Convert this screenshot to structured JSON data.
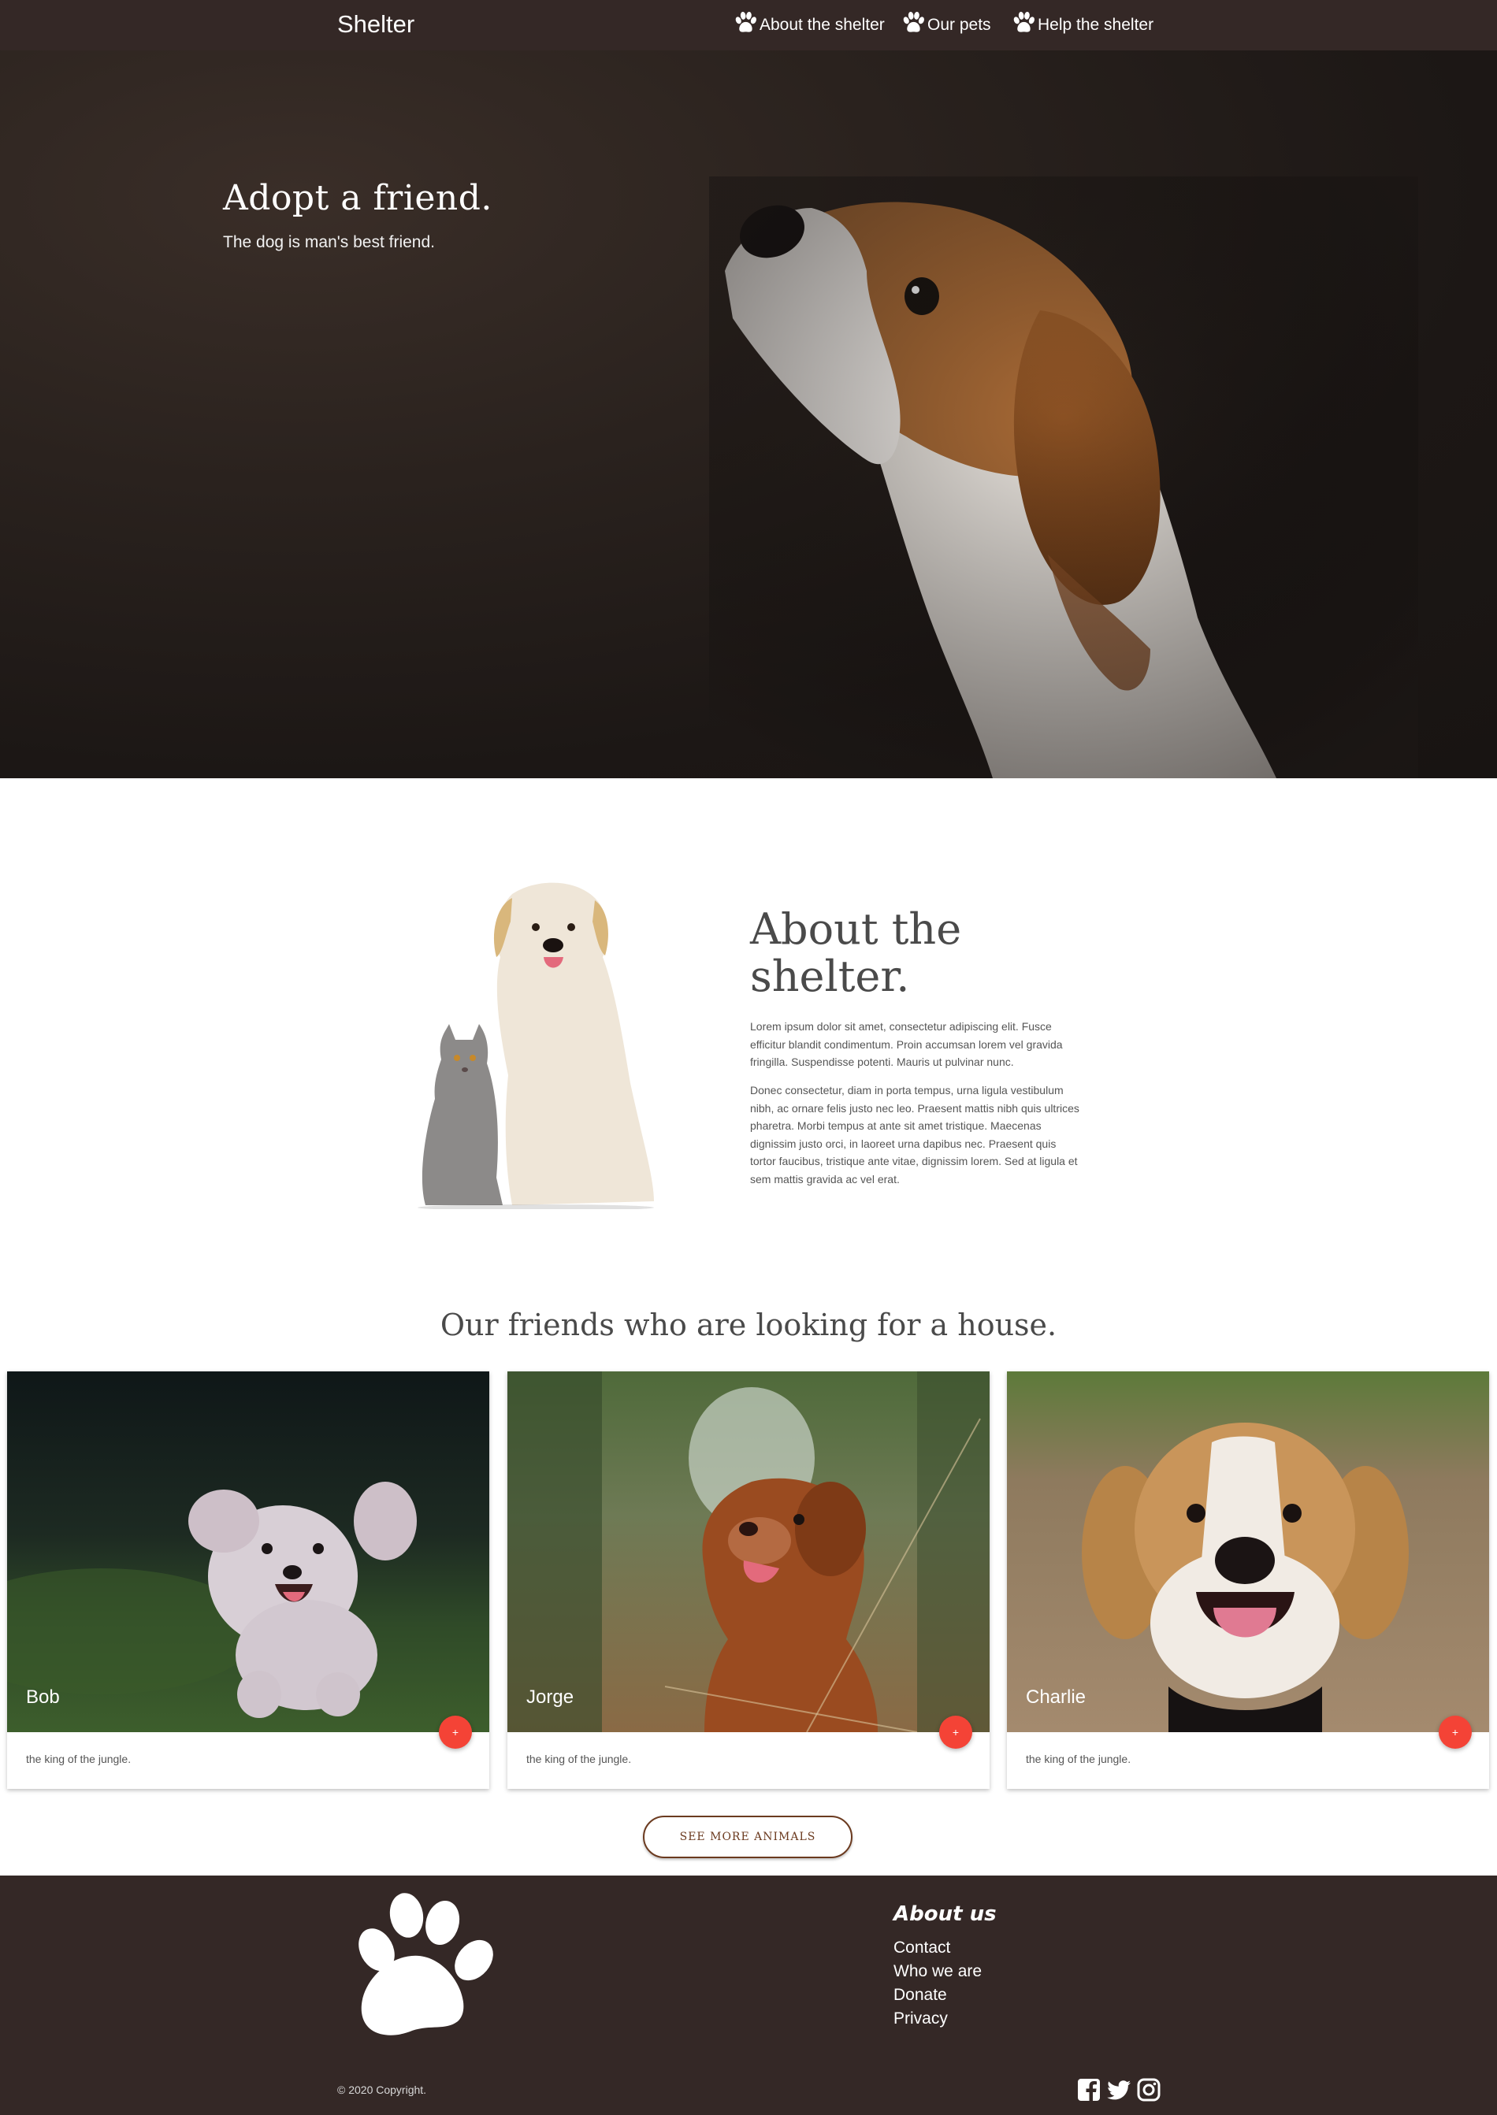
{
  "nav": {
    "brand": "Shelter",
    "links": [
      {
        "label": "About the shelter",
        "icon": "paw-icon"
      },
      {
        "label": "Our pets",
        "icon": "paw-icon"
      },
      {
        "label": "Help the shelter",
        "icon": "paw-icon"
      }
    ]
  },
  "hero": {
    "title": "Adopt a friend.",
    "subtitle": "The dog is man's best friend."
  },
  "about": {
    "title": "About the shelter.",
    "paragraphs": [
      "Lorem ipsum dolor sit amet, consectetur adipiscing elit. Fusce efficitur blandit condimentum. Proin accumsan lorem vel gravida fringilla. Suspendisse potenti. Mauris ut pulvinar nunc.",
      "Donec consectetur, diam in porta tempus, urna ligula vestibulum nibh, ac ornare felis justo nec leo. Praesent mattis nibh quis ultrices pharetra. Morbi tempus at ante sit amet tristique. Maecenas dignissim justo orci, in laoreet urna dapibus nec. Praesent quis tortor faucibus, tristique ante vitae, dignissim lorem. Sed at ligula et sem mattis gravida ac vel erat."
    ]
  },
  "pets": {
    "heading": "Our friends who are looking for a house.",
    "cards": [
      {
        "name": "Bob",
        "description": "the king of the jungle.",
        "fab": "+"
      },
      {
        "name": "Jorge",
        "description": "the king of the jungle.",
        "fab": "+"
      },
      {
        "name": "Charlie",
        "description": "the king of the jungle.",
        "fab": "+"
      }
    ],
    "more_button": "SEE MORE ANIMALS"
  },
  "footer": {
    "heading": "About us",
    "links": [
      "Contact",
      "Who we are",
      "Donate",
      "Privacy"
    ],
    "copyright": "© 2020 Copyright.",
    "socials": [
      "facebook-icon",
      "twitter-icon",
      "instagram-icon"
    ]
  },
  "colors": {
    "nav_bg": "#342826",
    "footer_bg": "#342826",
    "accent_fab": "#f44336",
    "button_border": "#6b3a1f"
  }
}
